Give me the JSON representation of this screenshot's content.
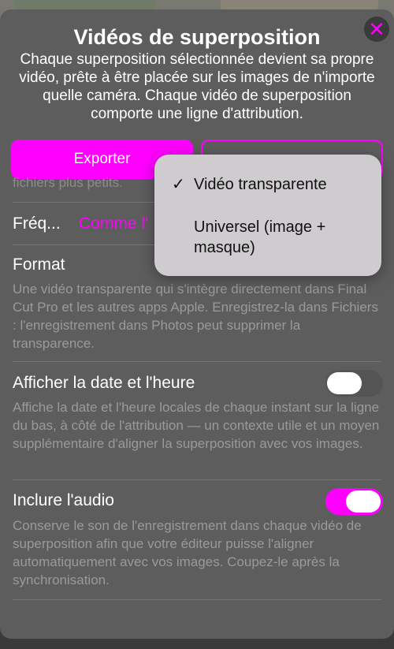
{
  "sheet": {
    "title": "Vidéos de superposition",
    "close_icon": "✕",
    "subtitle": "Chaque superposition sélectionnée devient sa propre vidéo, prête à être placée sur les images de n'importe quelle caméra. Chaque vidéo de superposition comporte une ligne d'attribution."
  },
  "buttons": {
    "export_label": "Exporter"
  },
  "partial_text": "fichiers plus petits.",
  "frequency": {
    "label": "Fréq...",
    "value": "Comme l'"
  },
  "format": {
    "label": "Format",
    "description": "Une vidéo transparente qui s'intègre directement dans Final Cut Pro et les autres apps Apple. Enregistrez-la dans Fichiers : l'enregistrement dans Photos peut supprimer la transparence."
  },
  "date_time": {
    "label": "Afficher la date et l'heure",
    "enabled": false,
    "description": "Affiche la date et l'heure locales de chaque instant sur la ligne du bas, à côté de l'attribution — un contexte utile et un moyen supplémentaire d'aligner la superposition avec vos images."
  },
  "audio": {
    "label": "Inclure l'audio",
    "enabled": true,
    "description": "Conserve le son de l'enregistrement dans chaque vidéo de superposition afin que votre éditeur puisse l'aligner automatiquement avec vos images. Coupez-le après la synchronisation."
  },
  "format_menu": {
    "check_mark": "✓",
    "options": [
      {
        "label": "Vidéo transparente",
        "selected": true
      },
      {
        "label": "Universel (image + masque)",
        "selected": false
      }
    ]
  },
  "colors": {
    "accent": "#ff00ff",
    "sheet_background": "#5d5d5d"
  }
}
